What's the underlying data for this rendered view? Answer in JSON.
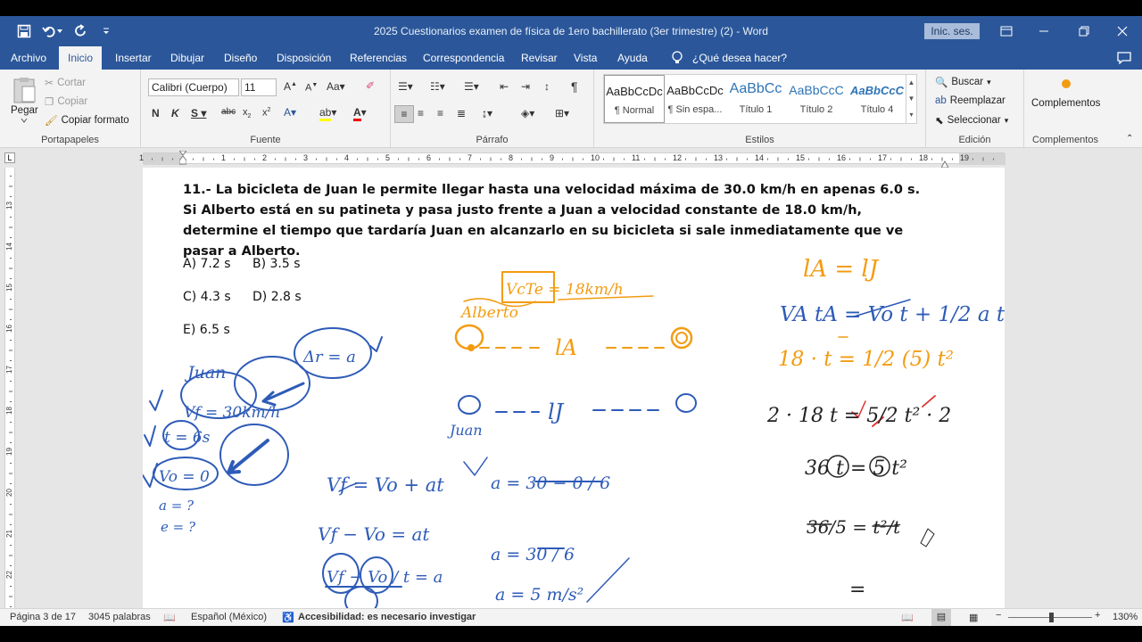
{
  "window": {
    "title": "2025 Cuestionarios examen de física de 1ero bachillerato (3er trimestre) (2)  -  Word",
    "signin": "Inic. ses."
  },
  "tabs": [
    "Archivo",
    "Inicio",
    "Insertar",
    "Dibujar",
    "Diseño",
    "Disposición",
    "Referencias",
    "Correspondencia",
    "Revisar",
    "Vista",
    "Ayuda"
  ],
  "tell_me": "¿Qué desea hacer?",
  "ribbon": {
    "clipboard": {
      "label": "Portapapeles",
      "paste": "Pegar",
      "cut": "Cortar",
      "copy": "Copiar",
      "format_painter": "Copiar formato"
    },
    "font": {
      "label": "Fuente",
      "name": "Calibri (Cuerpo)",
      "size": "11"
    },
    "paragraph": {
      "label": "Párrafo"
    },
    "styles": {
      "label": "Estilos",
      "items": [
        {
          "sample": "AaBbCcDc",
          "name": "¶ Normal"
        },
        {
          "sample": "AaBbCcDc",
          "name": "¶ Sin espa..."
        },
        {
          "sample": "AaBbCc",
          "name": "Título 1"
        },
        {
          "sample": "AaBbCcC",
          "name": "Título 2"
        },
        {
          "sample": "AaBbCcC",
          "name": "Título 4"
        }
      ]
    },
    "editing": {
      "label": "Edición",
      "find": "Buscar",
      "replace": "Reemplazar",
      "select": "Seleccionar"
    },
    "addins": {
      "label": "Complementos",
      "button": "Complementos"
    }
  },
  "document": {
    "question": "11.- La bicicleta de Juan le permite llegar hasta una velocidad máxima de 30.0 km/h en apenas 6.0 s. Si Alberto está en su patineta y pasa justo frente a Juan a velocidad constante de 18.0 km/h, determine el tiempo que tardaría Juan en alcanzarlo en su bicicleta si sale inmediatamente que ve pasar a Alberto.",
    "options": {
      "a": "A) 7.2 s",
      "b": "B) 3.5 s",
      "c": "C) 4.3 s",
      "d": "D) 2.8 s",
      "e": "E) 6.5 s"
    },
    "handwriting": {
      "juan_label": "Juan",
      "alberto_label": "Alberto",
      "vcte": "VcTe = 18km/h",
      "delta_r": "Δr = a",
      "vf": "Vf = 30km/h",
      "t": "t = 6s",
      "v0": "Vo = 0",
      "a_q": "a = ?",
      "e_q": "e = ?",
      "eq1": "Vf = Vo + at",
      "eq2": "Vf − Vo = at",
      "eq3": "Vf − Vo / t = a",
      "a1": "a = 30 − 0 / 6",
      "a2": "a = 30 / 6",
      "a3": "a = 5 m/s²",
      "la": "lA",
      "lj": "lJ",
      "r1": "lA = lJ",
      "r2": "VA tA = Vo t + 1/2 a t²",
      "r3": "18 · t = 1/2 (5) t²",
      "r4": "2 · 18 t = 5/2 t² · 2",
      "r5": "36 t = 5 t²",
      "r6": "36/5 = t²/t",
      "r7": "="
    }
  },
  "status": {
    "page": "Página 3 de 17",
    "words": "3045 palabras",
    "language": "Español (México)",
    "accessibility": "Accesibilidad: es necesario investigar",
    "zoom": "130%"
  },
  "ruler": {
    "h": [
      "1",
      "1",
      "2",
      "3",
      "4",
      "5",
      "6",
      "7",
      "8",
      "9",
      "10",
      "11",
      "12",
      "13",
      "14",
      "15",
      "16",
      "17",
      "18",
      "19"
    ],
    "v": [
      "13",
      "14",
      "15",
      "16",
      "17",
      "18",
      "19",
      "20",
      "21",
      "22",
      "23"
    ]
  },
  "colors": {
    "word_blue": "#2b579a",
    "ink_blue": "#2e5bb8",
    "ink_orange": "#f39c12",
    "ink_red": "#e03030"
  }
}
